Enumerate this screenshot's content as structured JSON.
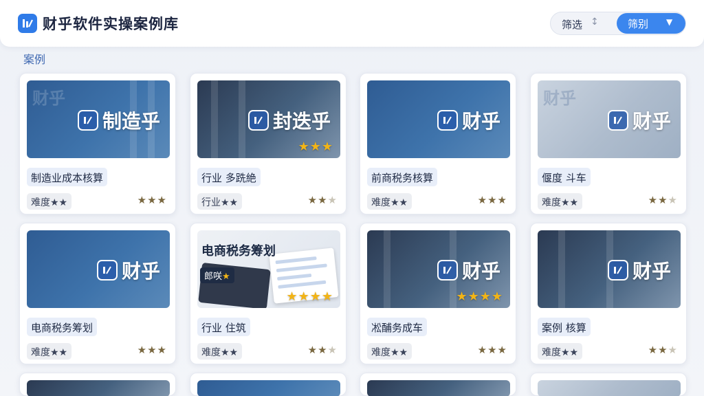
{
  "header": {
    "title": "财乎软件实操案例库",
    "filter_label": "筛选",
    "filter_spin": "↕",
    "filter_select": "筛别"
  },
  "section": {
    "label": "案例"
  },
  "colors": {
    "accent": "#3b86ee",
    "star": "#f2b417",
    "brand": "#2f7be8"
  },
  "cards": [
    {
      "brand_text": "制造乎",
      "thumb_stars": "",
      "title": "制造业成本核算",
      "difficulty": "难度★★",
      "stars": "★★★",
      "stars_dim": ""
    },
    {
      "brand_text": "封迭乎",
      "thumb_stars": "★★★",
      "title": "行业  多跣絶",
      "difficulty": "行业★★",
      "stars": "★★",
      "stars_dim": "★"
    },
    {
      "brand_text": "财乎",
      "thumb_stars": "",
      "title": "前商税务核算",
      "difficulty": "难度★★",
      "stars": "★★★",
      "stars_dim": ""
    },
    {
      "brand_text": "财乎",
      "thumb_stars": "",
      "title": "偃度  斗车",
      "difficulty": "难度★★",
      "stars": "★★",
      "stars_dim": "★"
    },
    {
      "brand_text": "财乎",
      "thumb_stars": "",
      "title": "电商税务筹划",
      "difficulty": "难度★★",
      "stars": "★★★",
      "stars_dim": ""
    },
    {
      "brand_text": "",
      "thumb_stars": "★★★★",
      "paper_title": "电商税务筹划",
      "paper_tag": "郎咲",
      "paper_tag_star": "★",
      "title": "行业  住筑",
      "difficulty": "难度★★",
      "stars": "★★",
      "stars_dim": "★"
    },
    {
      "brand_text": "财乎",
      "thumb_stars": "★★★★",
      "title": "凇酺务成车",
      "difficulty": "难度★★",
      "stars": "★★★",
      "stars_dim": ""
    },
    {
      "brand_text": "财乎",
      "thumb_stars": "",
      "title": "案例  核算",
      "difficulty": "难度★★",
      "stars": "★★",
      "stars_dim": "★"
    }
  ]
}
